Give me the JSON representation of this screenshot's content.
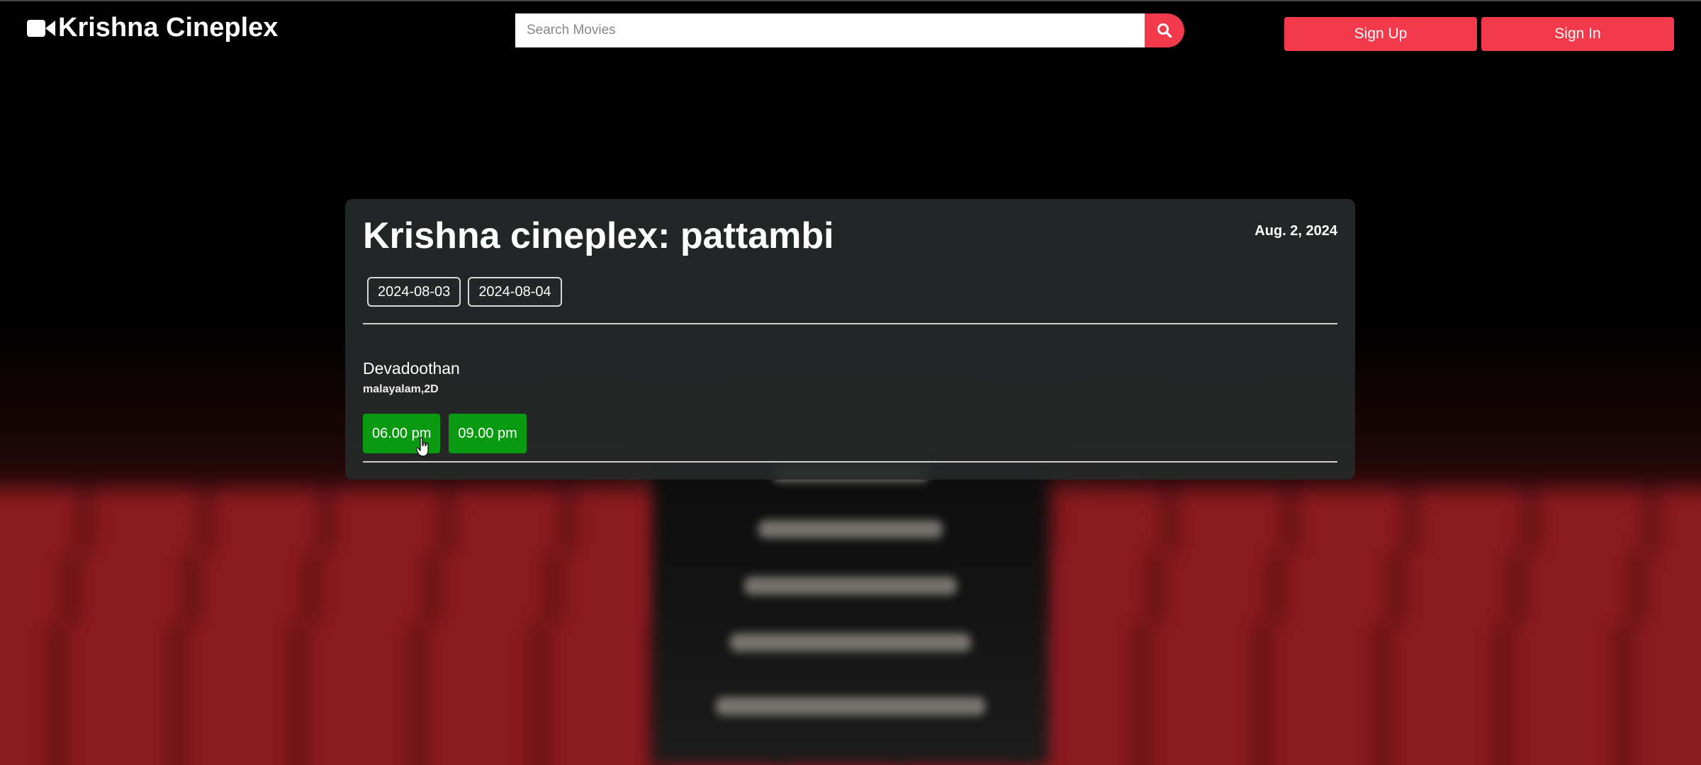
{
  "header": {
    "brand": "Krishna Cineplex",
    "brand_icon": "video-camera-icon",
    "search": {
      "placeholder": "Search Movies",
      "value": "",
      "button_icon": "search-icon"
    },
    "auth": {
      "signup_label": "Sign Up",
      "signin_label": "Sign In"
    }
  },
  "theater": {
    "title": "Krishna cineplex: pattambi",
    "date": "Aug. 2, 2024",
    "date_options": [
      "2024-08-03",
      "2024-08-04"
    ]
  },
  "movies": [
    {
      "title": "Devadoothan",
      "meta": "malayalam,2D",
      "showtimes": [
        "06.00 pm",
        "09.00 pm"
      ]
    }
  ],
  "colors": {
    "accent": "#f23a4c",
    "showtime": "#0a9a12",
    "card": "#262929"
  }
}
